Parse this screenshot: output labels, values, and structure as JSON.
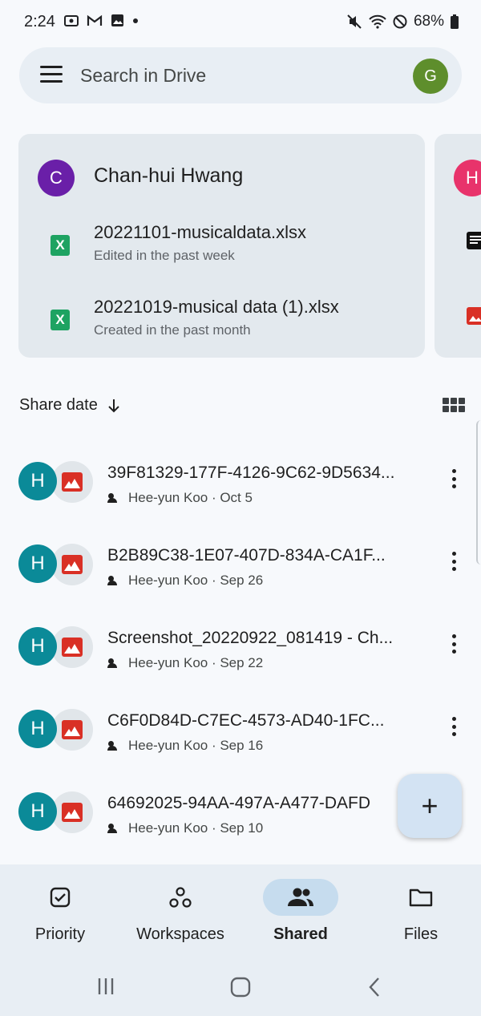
{
  "status_bar": {
    "time": "2:24",
    "battery": "68%"
  },
  "search": {
    "placeholder": "Search in Drive",
    "account_initial": "G",
    "account_color": "#5e8e2c"
  },
  "suggestion_card": {
    "person_initial": "C",
    "person_name": "Chan-hui Hwang",
    "files": [
      {
        "name": "20221101-musicaldata.xlsx",
        "subtitle": "Edited in the past week",
        "icon": "sheets-icon"
      },
      {
        "name": "20221019-musical data (1).xlsx",
        "subtitle": "Created in the past month",
        "icon": "sheets-icon"
      }
    ],
    "next_card_initial": "H"
  },
  "sort": {
    "label": "Share date"
  },
  "files": [
    {
      "owner_initial": "H",
      "title": "39F81329-177F-4126-9C62-9D5634...",
      "meta": "Hee-yun Koo · Oct 5"
    },
    {
      "owner_initial": "H",
      "title": "B2B89C38-1E07-407D-834A-CA1F...",
      "meta": "Hee-yun Koo · Sep 26"
    },
    {
      "owner_initial": "H",
      "title": "Screenshot_20220922_081419 - Ch...",
      "meta": "Hee-yun Koo · Sep 22"
    },
    {
      "owner_initial": "H",
      "title": "C6F0D84D-C7EC-4573-AD40-1FC...",
      "meta": "Hee-yun Koo · Sep 16"
    },
    {
      "owner_initial": "H",
      "title": "64692025-94AA-497A-A477-DAFD",
      "meta": "Hee-yun Koo · Sep 10"
    }
  ],
  "fab": {
    "label": "+"
  },
  "bottom_nav": {
    "items": [
      {
        "label": "Priority",
        "icon": "priority-icon"
      },
      {
        "label": "Workspaces",
        "icon": "workspaces-icon"
      },
      {
        "label": "Shared",
        "icon": "shared-icon",
        "active": true
      },
      {
        "label": "Files",
        "icon": "folder-icon"
      }
    ]
  },
  "colors": {
    "owner_avatar": "#0b8a98",
    "card_avatar": "#6a1fa8",
    "next_card_avatar": "#e8336b",
    "image_icon": "#d93025",
    "sheets_icon": "#1ea362"
  }
}
